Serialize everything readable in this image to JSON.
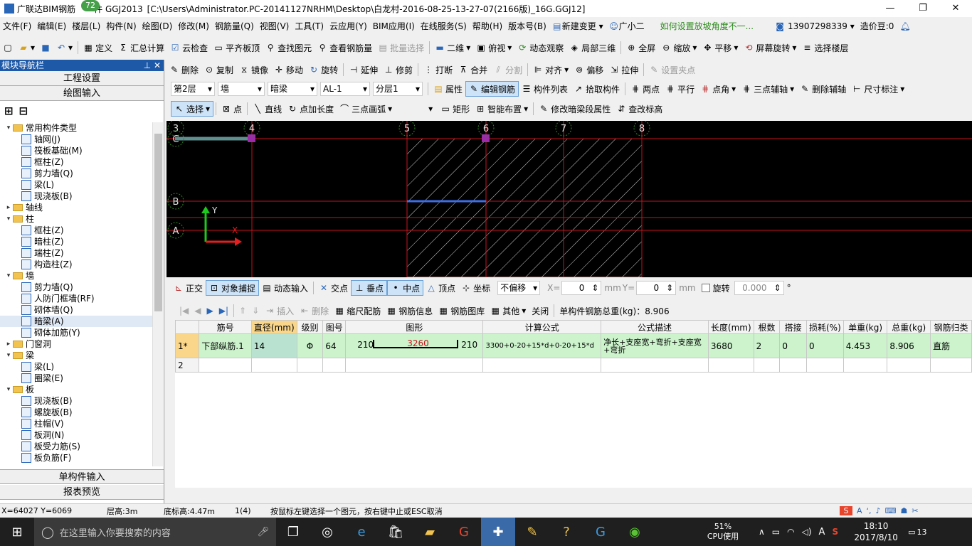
{
  "title_bar": {
    "app_name": "广联达BIM钢筋",
    "badge": "72",
    "file_label": "件 GGJ2013",
    "path": "[C:\\Users\\Administrator.PC-20141127NRHM\\Desktop\\白龙村-2016-08-25-13-27-07(2166版)_16G.GGJ12]"
  },
  "menu": [
    "文件(F)",
    "编辑(E)",
    "楼层(L)",
    "构件(N)",
    "绘图(D)",
    "修改(M)",
    "钢筋量(Q)",
    "视图(V)",
    "工具(T)",
    "云应用(Y)",
    "BIM应用(I)",
    "在线服务(S)",
    "帮助(H)",
    "版本号(B)",
    "新建变更",
    "广小二"
  ],
  "menu_right": {
    "question": "如何设置放坡角度不一...",
    "phone": "13907298339",
    "beans": "造价豆:0"
  },
  "toolbar1": [
    "定义",
    "汇总计算",
    "云检查",
    "平齐板顶",
    "查找图元",
    "查看钢筋量",
    "批量选择",
    "二维",
    "俯视",
    "动态观察",
    "局部三维",
    "全屏",
    "缩放",
    "平移",
    "屏幕旋转",
    "选择楼层"
  ],
  "toolbar2": [
    "删除",
    "复制",
    "镜像",
    "移动",
    "旋转",
    "延伸",
    "修剪",
    "打断",
    "合并",
    "分割",
    "对齐",
    "偏移",
    "拉伸",
    "设置夹点"
  ],
  "toolbar3": {
    "floor": "第2层",
    "type": "墙",
    "sub": "暗梁",
    "name": "AL-1",
    "layer": "分层1",
    "buttons": [
      "属性",
      "编辑钢筋",
      "构件列表",
      "拾取构件",
      "两点",
      "平行",
      "点角",
      "三点辅轴",
      "删除辅轴",
      "尺寸标注"
    ]
  },
  "toolbar4": [
    "选择",
    "点",
    "直线",
    "点加长度",
    "三点画弧",
    "矩形",
    "智能布置",
    "修改暗梁段属性",
    "查改标高"
  ],
  "nav": {
    "title": "模块导航栏",
    "btn_top1": "工程设置",
    "btn_top2": "绘图输入",
    "btn_bottom1": "单构件输入",
    "btn_bottom2": "报表预览",
    "tree": [
      {
        "lvl": 0,
        "tw": "▾",
        "kind": "folder",
        "label": "常用构件类型"
      },
      {
        "lvl": 1,
        "kind": "item",
        "label": "轴网(J)"
      },
      {
        "lvl": 1,
        "kind": "item",
        "label": "筏板基础(M)"
      },
      {
        "lvl": 1,
        "kind": "item",
        "label": "框柱(Z)"
      },
      {
        "lvl": 1,
        "kind": "item",
        "label": "剪力墙(Q)"
      },
      {
        "lvl": 1,
        "kind": "item",
        "label": "梁(L)"
      },
      {
        "lvl": 1,
        "kind": "item",
        "label": "现浇板(B)"
      },
      {
        "lvl": 0,
        "tw": "▸",
        "kind": "folder",
        "label": "轴线"
      },
      {
        "lvl": 0,
        "tw": "▾",
        "kind": "folder",
        "label": "柱"
      },
      {
        "lvl": 1,
        "kind": "item",
        "label": "框柱(Z)"
      },
      {
        "lvl": 1,
        "kind": "item",
        "label": "暗柱(Z)"
      },
      {
        "lvl": 1,
        "kind": "item",
        "label": "端柱(Z)"
      },
      {
        "lvl": 1,
        "kind": "item",
        "label": "构造柱(Z)"
      },
      {
        "lvl": 0,
        "tw": "▾",
        "kind": "folder",
        "label": "墙"
      },
      {
        "lvl": 1,
        "kind": "item",
        "label": "剪力墙(Q)"
      },
      {
        "lvl": 1,
        "kind": "item",
        "label": "人防门框墙(RF)"
      },
      {
        "lvl": 1,
        "kind": "item",
        "label": "砌体墙(Q)"
      },
      {
        "lvl": 1,
        "kind": "item",
        "label": "暗梁(A)",
        "selected": true
      },
      {
        "lvl": 1,
        "kind": "item",
        "label": "砌体加筋(Y)"
      },
      {
        "lvl": 0,
        "tw": "▸",
        "kind": "folder",
        "label": "门窗洞"
      },
      {
        "lvl": 0,
        "tw": "▾",
        "kind": "folder",
        "label": "梁"
      },
      {
        "lvl": 1,
        "kind": "item",
        "label": "梁(L)"
      },
      {
        "lvl": 1,
        "kind": "item",
        "label": "圈梁(E)"
      },
      {
        "lvl": 0,
        "tw": "▾",
        "kind": "folder",
        "label": "板"
      },
      {
        "lvl": 1,
        "kind": "item",
        "label": "现浇板(B)"
      },
      {
        "lvl": 1,
        "kind": "item",
        "label": "螺旋板(B)"
      },
      {
        "lvl": 1,
        "kind": "item",
        "label": "柱帽(V)"
      },
      {
        "lvl": 1,
        "kind": "item",
        "label": "板洞(N)"
      },
      {
        "lvl": 1,
        "kind": "item",
        "label": "板受力筋(S)"
      },
      {
        "lvl": 1,
        "kind": "item",
        "label": "板负筋(F)"
      }
    ]
  },
  "canvas": {
    "axes_top": [
      "3",
      "4",
      "5",
      "6",
      "7",
      "8"
    ],
    "axes_left": [
      "C",
      "B",
      "A"
    ],
    "ucs_x": "X",
    "ucs_y": "Y"
  },
  "snapbar": {
    "buttons": [
      "正交",
      "对象捕捉",
      "动态输入",
      "交点",
      "垂点",
      "中点",
      "顶点",
      "坐标"
    ],
    "offset": "不偏移",
    "x_label": "X=",
    "x_val": "0",
    "y_label": "Y=",
    "y_val": "0",
    "unit": "mm",
    "rotate_label": "旋转",
    "rotate_val": "0.000",
    "deg": "°"
  },
  "grid_toolbar": {
    "buttons": [
      "插入",
      "删除",
      "缩尺配筋",
      "钢筋信息",
      "钢筋图库",
      "其他",
      "关闭"
    ],
    "total": "单构件钢筋总重(kg)：8.906"
  },
  "grid": {
    "headers": [
      "筋号",
      "直径(mm)",
      "级别",
      "图号",
      "图形",
      "计算公式",
      "公式描述",
      "长度(mm)",
      "根数",
      "搭接",
      "损耗(%)",
      "单重(kg)",
      "总重(kg)",
      "钢筋归类"
    ],
    "rows": [
      {
        "idx": "1*",
        "name": "下部纵筋.1",
        "dia": "14",
        "grade": "Φ",
        "fig": "64",
        "shape_left": "210",
        "shape_mid": "3260",
        "shape_right": "210",
        "formula": "3300+0-20+15*d+0-20+15*d",
        "desc": "净长+支座宽+弯折+支座宽+弯折",
        "len": "3680",
        "count": "2",
        "lap": "0",
        "loss": "0",
        "unit_w": "4.453",
        "total_w": "8.906",
        "cat": "直筋"
      },
      {
        "idx": "2",
        "name": "",
        "dia": "",
        "grade": "",
        "fig": "",
        "shape_left": "",
        "shape_mid": "",
        "shape_right": "",
        "formula": "",
        "desc": "",
        "len": "",
        "count": "",
        "lap": "",
        "loss": "",
        "unit_w": "",
        "total_w": "",
        "cat": ""
      }
    ]
  },
  "status": {
    "coords": "X=64027 Y=6069",
    "floor_h": "层高:3m",
    "base_h": "底标高:4.47m",
    "count": "1(4)",
    "hint": "按鼠标左键选择一个图元，按右键中止或ESC取消"
  },
  "taskbar": {
    "search": "在这里输入你要搜索的内容",
    "cpu": "51%",
    "cpu_label": "CPU使用",
    "time": "18:10",
    "date": "2017/8/10",
    "notif": "13",
    "ime": "A"
  }
}
